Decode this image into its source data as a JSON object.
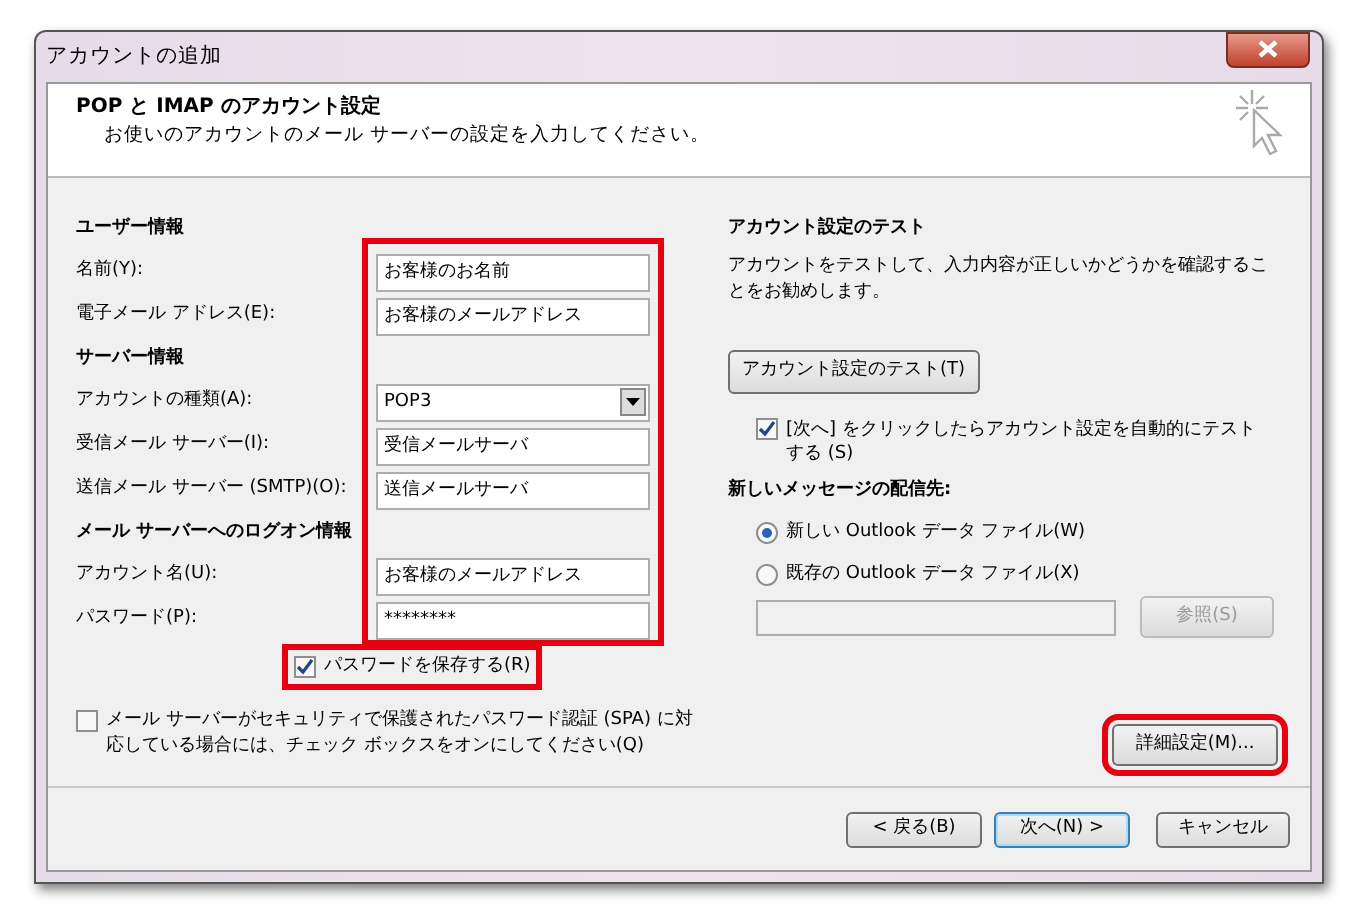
{
  "window": {
    "title": "アカウントの追加"
  },
  "header": {
    "title": "POP と IMAP のアカウント設定",
    "subtitle": "お使いのアカウントのメール サーバーの設定を入力してください。"
  },
  "form": {
    "highlighted": true,
    "sections": [
      {
        "heading": "ユーザー情報",
        "fields": [
          {
            "kind": "text",
            "label": "名前(Y):",
            "value": "お客様のお名前"
          },
          {
            "kind": "text",
            "label": "電子メール アドレス(E):",
            "value": "お客様のメールアドレス"
          }
        ]
      },
      {
        "heading": "サーバー情報",
        "fields": [
          {
            "kind": "select",
            "label": "アカウントの種類(A):",
            "value": "POP3"
          },
          {
            "kind": "text",
            "label": "受信メール サーバー(I):",
            "value": "受信メールサーバ"
          },
          {
            "kind": "text",
            "label": "送信メール サーバー (SMTP)(O):",
            "value": "送信メールサーバ"
          }
        ]
      },
      {
        "heading": "メール サーバーへのログオン情報",
        "fields": [
          {
            "kind": "text",
            "label": "アカウント名(U):",
            "value": "お客様のメールアドレス"
          },
          {
            "kind": "password",
            "label": "パスワード(P):",
            "value": "********"
          }
        ]
      }
    ]
  },
  "save_password": {
    "label": "パスワードを保存する(R)",
    "checked": true,
    "highlighted": true
  },
  "spa": {
    "label": "メール サーバーがセキュリティで保護されたパスワード認証 (SPA) に対応している場合には、チェック ボックスをオンにしてください(Q)",
    "checked": false
  },
  "test": {
    "heading": "アカウント設定のテスト",
    "description": "アカウントをテストして、入力内容が正しいかどうかを確認することをお勧めします。",
    "button": "アカウント設定のテスト(T)",
    "auto_test": {
      "label": "[次へ] をクリックしたらアカウント設定を自動的にテストする (S)",
      "checked": true
    }
  },
  "delivery": {
    "heading": "新しいメッセージの配信先:",
    "options": [
      {
        "label": "新しい Outlook データ ファイル(W)",
        "selected": true
      },
      {
        "label": "既存の Outlook データ ファイル(X)",
        "selected": false
      }
    ],
    "browse_button": "参照(S)"
  },
  "advanced_button": {
    "label": "詳細設定(M)...",
    "highlighted": true
  },
  "buttons": [
    {
      "label": "< 戻る(B)",
      "default": false
    },
    {
      "label": "次へ(N) >",
      "default": true
    },
    {
      "label": "キャンセル",
      "default": false
    }
  ]
}
